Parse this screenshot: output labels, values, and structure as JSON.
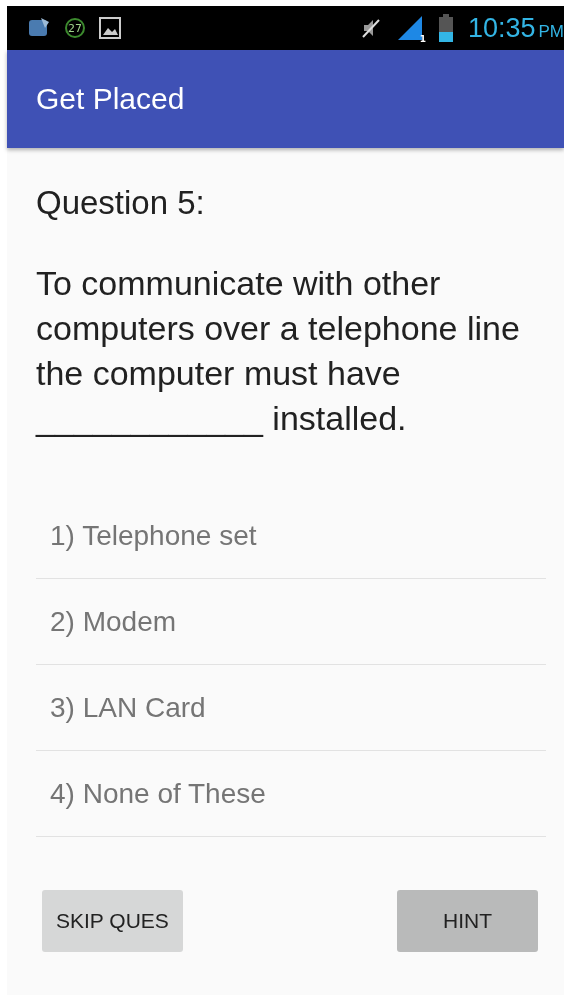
{
  "status_bar": {
    "notification_count": "27",
    "sim_slot": "1",
    "time": "10:35",
    "meridiem": "PM"
  },
  "app_bar": {
    "title": "Get Placed"
  },
  "question": {
    "label": "Question 5:",
    "text": "To communicate with other computers over a telephone line the computer must have ____________ installed."
  },
  "options": [
    {
      "label": "1) Telephone set"
    },
    {
      "label": "2) Modem"
    },
    {
      "label": "3) LAN Card"
    },
    {
      "label": "4) None of These"
    }
  ],
  "buttons": [
    {
      "label": "SKIP QUES",
      "pressed": false
    },
    {
      "label": "HINT",
      "pressed": true
    }
  ]
}
